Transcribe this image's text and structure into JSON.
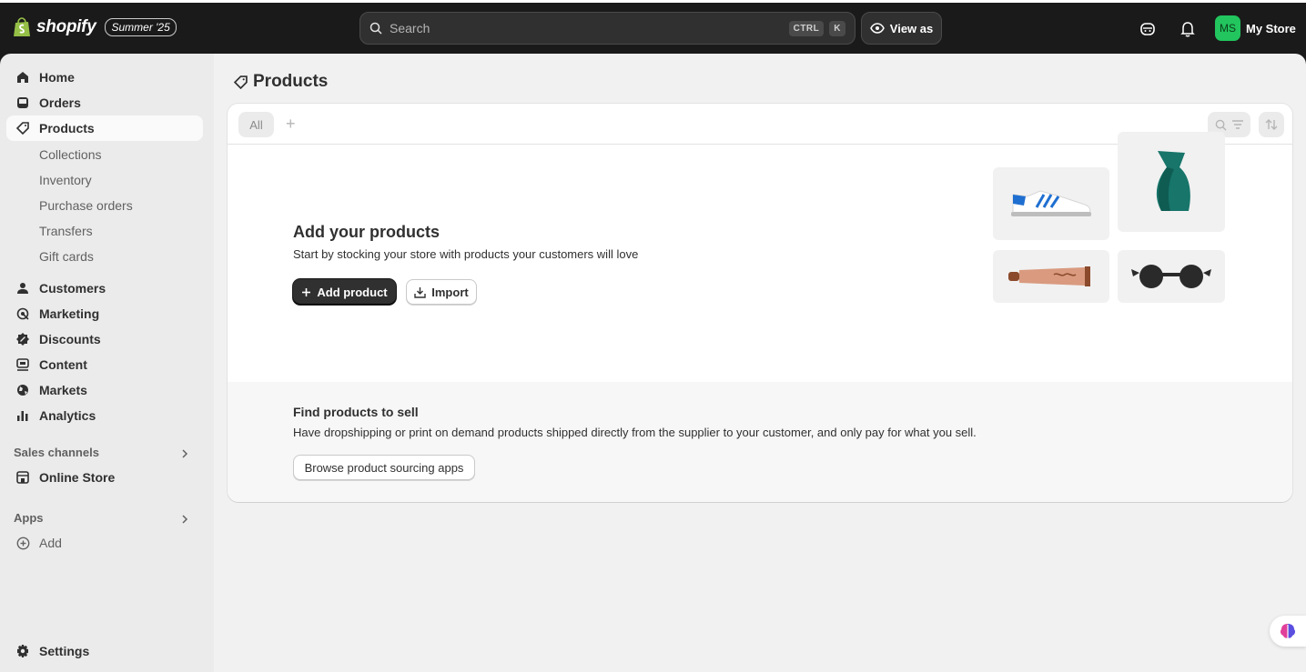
{
  "topbar": {
    "brand": "shopify",
    "edition": "Summer '25",
    "search_placeholder": "Search",
    "shortcut_ctrl": "CTRL",
    "shortcut_key": "K",
    "view_as": "View as",
    "store_initials": "MS",
    "store_name": "My Store"
  },
  "sidebar": {
    "home": "Home",
    "orders": "Orders",
    "products": "Products",
    "sub": [
      "Collections",
      "Inventory",
      "Purchase orders",
      "Transfers",
      "Gift cards"
    ],
    "customers": "Customers",
    "marketing": "Marketing",
    "discounts": "Discounts",
    "content": "Content",
    "markets": "Markets",
    "analytics": "Analytics",
    "sales_channels": "Sales channels",
    "online_store": "Online Store",
    "apps": "Apps",
    "add": "Add",
    "settings": "Settings"
  },
  "main": {
    "title": "Products",
    "tab_all": "All",
    "empty_title": "Add your products",
    "empty_desc": "Start by stocking your store with products your customers will love",
    "add_product": "Add product",
    "import": "Import",
    "find_title": "Find products to sell",
    "find_desc": "Have dropshipping or print on demand products shipped directly from the supplier to your customer, and only pay for what you sell.",
    "browse": "Browse product sourcing apps"
  },
  "colors": {
    "topbar": "#1a1a1a",
    "avatar": "#22c55e",
    "primary_button": "#303030"
  }
}
